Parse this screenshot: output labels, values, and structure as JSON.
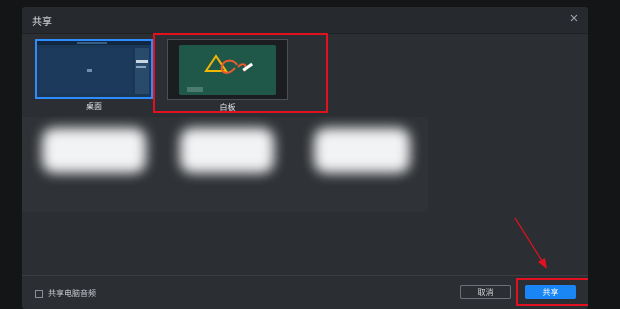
{
  "dialog": {
    "title": "共享",
    "close_icon": "close-icon"
  },
  "sources": [
    {
      "label": "桌面",
      "selected": true
    },
    {
      "label": "白板",
      "selected": false
    }
  ],
  "footer": {
    "share_audio_label": "共享电脑音频",
    "share_audio_checked": false,
    "cancel_label": "取消",
    "share_label": "共享"
  },
  "colors": {
    "accent": "#1a86f5",
    "annotation_red": "#e2111f",
    "whiteboard_green": "#1f5848"
  }
}
